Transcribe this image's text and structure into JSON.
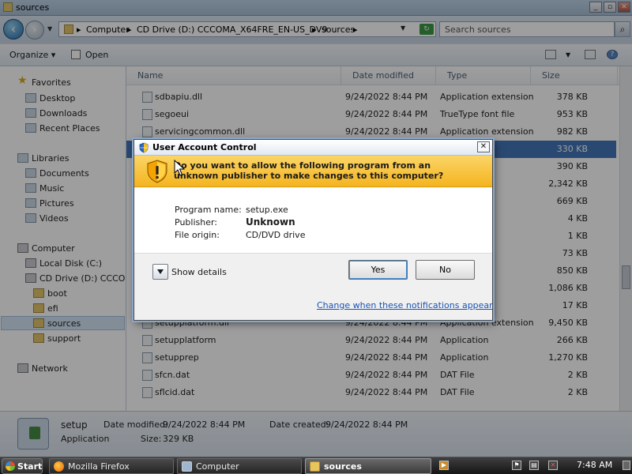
{
  "explorer": {
    "title": "sources",
    "address": {
      "breadcrumbs": [
        "Computer",
        "CD Drive (D:) CCCOMA_X64FRE_EN-US_DV9",
        "sources"
      ]
    },
    "search": {
      "placeholder": "Search sources"
    },
    "toolbar": {
      "organize": "Organize",
      "open": "Open"
    },
    "nav_pane": {
      "favorites": {
        "label": "Favorites",
        "items": [
          "Desktop",
          "Downloads",
          "Recent Places"
        ]
      },
      "libraries": {
        "label": "Libraries",
        "items": [
          "Documents",
          "Music",
          "Pictures",
          "Videos"
        ]
      },
      "computer": {
        "label": "Computer",
        "items": [
          "Local Disk (C:)",
          "CD Drive (D:) CCCOMA"
        ],
        "cd_children": [
          "boot",
          "efi",
          "sources",
          "support"
        ]
      },
      "network": "Network"
    },
    "columns": {
      "name": "Name",
      "date": "Date modified",
      "type": "Type",
      "size": "Size"
    },
    "files": [
      {
        "name": "sdbapiu.dll",
        "date": "9/24/2022 8:44 PM",
        "type": "Application extension",
        "size": "378 KB"
      },
      {
        "name": "segoeui",
        "date": "9/24/2022 8:44 PM",
        "type": "TrueType font file",
        "size": "953 KB"
      },
      {
        "name": "servicingcommon.dll",
        "date": "9/24/2022 8:44 PM",
        "type": "Application extension",
        "size": "982 KB"
      },
      {
        "name": "",
        "date": "",
        "type": "",
        "size": "330 KB",
        "selected": true
      },
      {
        "name": "",
        "date": "",
        "type": "ension",
        "size": "390 KB"
      },
      {
        "name": "",
        "date": "",
        "type": "ension",
        "size": "2,342 KB"
      },
      {
        "name": "",
        "date": "",
        "type": "",
        "size": "669 KB"
      },
      {
        "name": "",
        "date": "",
        "type": "",
        "size": "4 KB"
      },
      {
        "name": "",
        "date": "",
        "type": "",
        "size": "1 KB"
      },
      {
        "name": "",
        "date": "",
        "type": "",
        "size": "73 KB"
      },
      {
        "name": "",
        "date": "",
        "type": "",
        "size": "850 KB"
      },
      {
        "name": "",
        "date": "",
        "type": "ension",
        "size": "1,086 KB"
      },
      {
        "name": "",
        "date": "",
        "type": "",
        "size": "17 KB"
      },
      {
        "name": "setupplatform.dll",
        "date": "9/24/2022 8:44 PM",
        "type": "Application extension",
        "size": "9,450 KB"
      },
      {
        "name": "setupplatform",
        "date": "9/24/2022 8:44 PM",
        "type": "Application",
        "size": "266 KB"
      },
      {
        "name": "setupprep",
        "date": "9/24/2022 8:44 PM",
        "type": "Application",
        "size": "1,270 KB"
      },
      {
        "name": "sfcn.dat",
        "date": "9/24/2022 8:44 PM",
        "type": "DAT File",
        "size": "2 KB"
      },
      {
        "name": "sflcid.dat",
        "date": "9/24/2022 8:44 PM",
        "type": "DAT File",
        "size": "2 KB"
      }
    ],
    "details": {
      "name": "setup",
      "kind": "Application",
      "date_modified_label": "Date modified:",
      "date_modified": "9/24/2022 8:44 PM",
      "date_created_label": "Date created:",
      "date_created": "9/24/2022 8:44 PM",
      "size_label": "Size:",
      "size": "329 KB"
    }
  },
  "uac": {
    "title": "User Account Control",
    "question": "Do you want to allow the following program from an unknown publisher to make changes to this computer?",
    "program_name_label": "Program name:",
    "program_name": "setup.exe",
    "publisher_label": "Publisher:",
    "publisher": "Unknown",
    "file_origin_label": "File origin:",
    "file_origin": "CD/DVD drive",
    "show_details": "Show details",
    "yes": "Yes",
    "no": "No",
    "notifications_link": "Change when these notifications appear",
    "accent": "#f4b41f"
  },
  "taskbar": {
    "start": "Start",
    "tasks": [
      {
        "label": "Mozilla Firefox",
        "icon": "firefox-icon"
      },
      {
        "label": "Computer",
        "icon": "computer-icon"
      },
      {
        "label": "sources",
        "icon": "folder-icon",
        "active": true
      }
    ],
    "clock": "7:48 AM"
  }
}
